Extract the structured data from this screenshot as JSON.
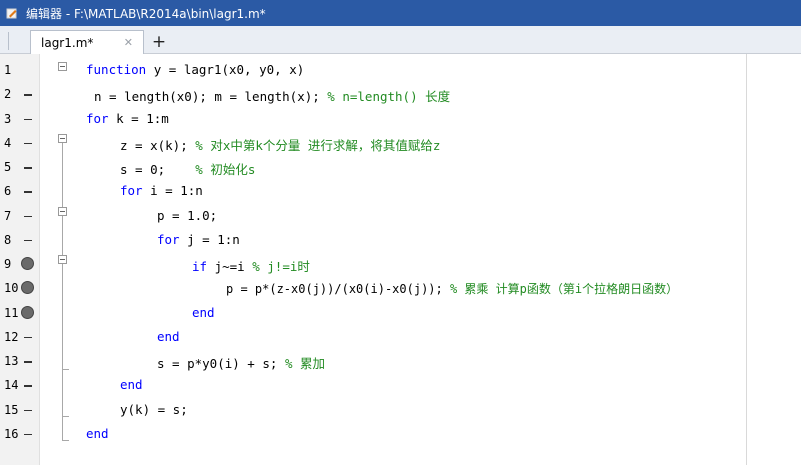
{
  "window": {
    "title": "编辑器 - F:\\MATLAB\\R2014a\\bin\\lagr1.m*"
  },
  "tabs": [
    {
      "label": "lagr1.m*",
      "close_icon": "✕"
    }
  ],
  "new_tab_label": "+",
  "code_lines": [
    {
      "num": "1",
      "marker": "none"
    },
    {
      "num": "2",
      "marker": "dash"
    },
    {
      "num": "3",
      "marker": "dash"
    },
    {
      "num": "4",
      "marker": "dash"
    },
    {
      "num": "5",
      "marker": "dash"
    },
    {
      "num": "6",
      "marker": "dash"
    },
    {
      "num": "7",
      "marker": "dash"
    },
    {
      "num": "8",
      "marker": "dash"
    },
    {
      "num": "9",
      "marker": "breakpoint"
    },
    {
      "num": "10",
      "marker": "breakpoint"
    },
    {
      "num": "11",
      "marker": "breakpoint"
    },
    {
      "num": "12",
      "marker": "dash"
    },
    {
      "num": "13",
      "marker": "dash"
    },
    {
      "num": "14",
      "marker": "dash"
    },
    {
      "num": "15",
      "marker": "dash"
    },
    {
      "num": "16",
      "marker": "dash"
    }
  ],
  "code": {
    "l1_kw": "function",
    "l1_rest": " y = lagr1(x0, y0, x)",
    "l2_code": "n = length(x0); m = length(x); ",
    "l2_cm": "% n=length() 长度",
    "l3_kw": "for",
    "l3_rest": " k = 1:m",
    "l4_code": "z = x(k); ",
    "l4_cm": "% 对x中第k个分量 进行求解，将其值赋给z",
    "l5_code": "s = 0;    ",
    "l5_cm": "% 初始化s",
    "l6_kw": "for",
    "l6_rest": " i = 1:n",
    "l7_code": "p = 1.0;",
    "l8_kw": "for",
    "l8_rest": " j = 1:n",
    "l9_kw": "if",
    "l9_rest": " j~=i ",
    "l9_cm": "% j!=i时",
    "l10_code": "p = p*(z-x0(j))/(x0(i)-x0(j)); ",
    "l10_cm": "% 累乘 计算p函数（第i个拉格朗日函数）",
    "l11_kw": "end",
    "l12_kw": "end",
    "l13_code": "s = p*y0(i) + s; ",
    "l13_cm": "% 累加",
    "l14_kw": "end",
    "l15_code": "y(k) = s;",
    "l16_kw": "end"
  },
  "colors": {
    "keyword": "#0000ff",
    "comment": "#228b22",
    "titlebar": "#2b5aa5"
  }
}
